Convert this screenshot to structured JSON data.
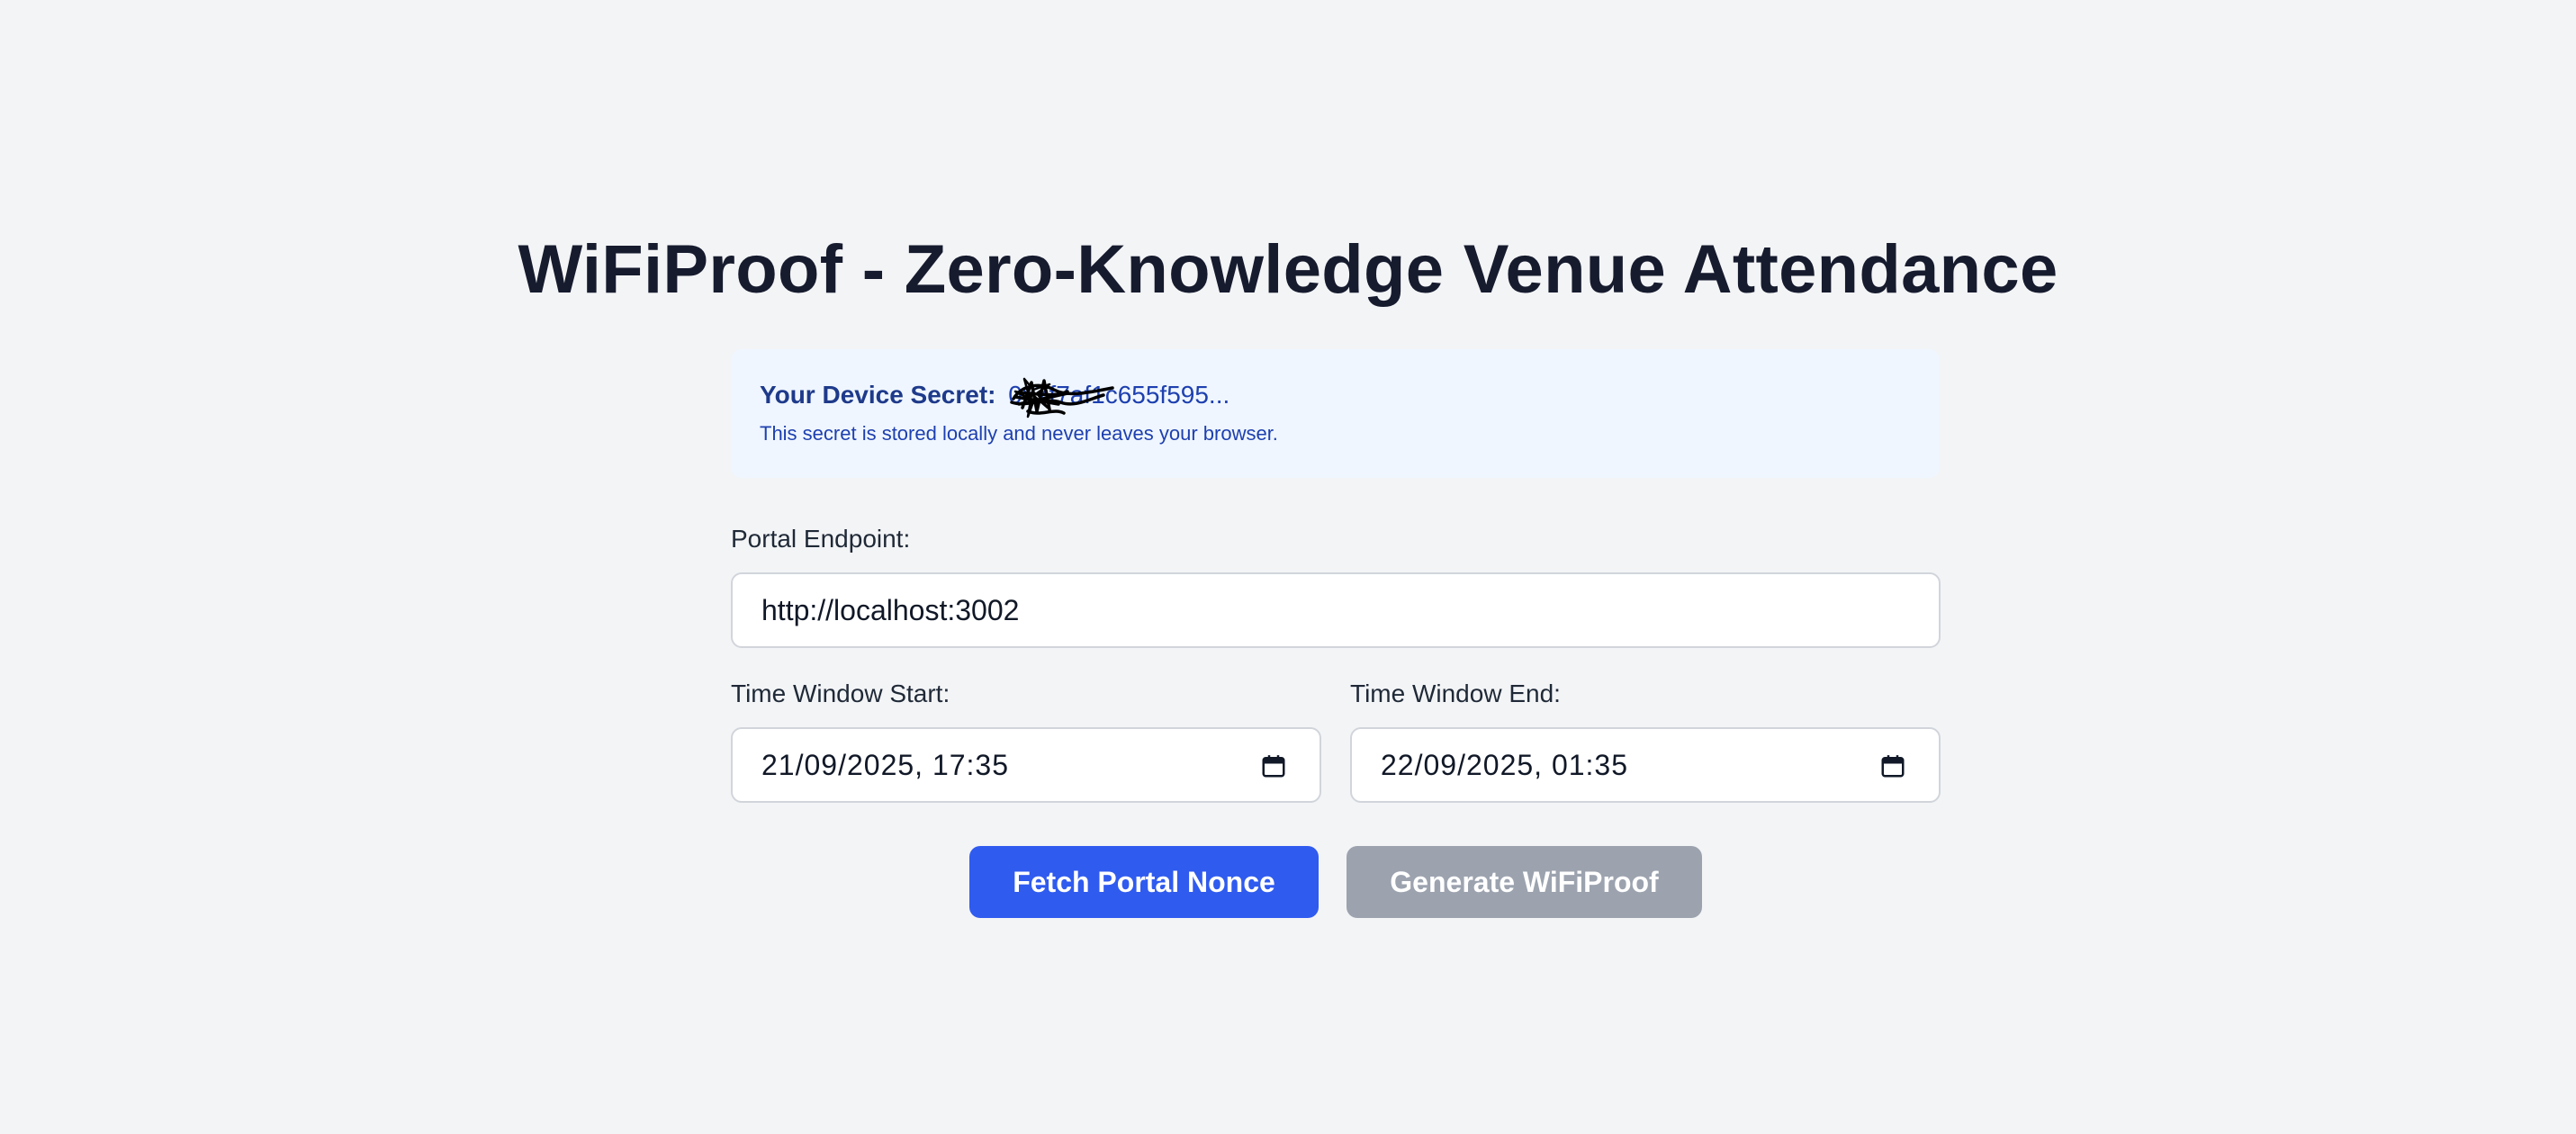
{
  "page": {
    "title": "WiFiProof - Zero-Knowledge Venue Attendance"
  },
  "secret": {
    "label": "Your Device Secret:",
    "value": "0x7f7af1c655f595...",
    "note": "This secret is stored locally and never leaves your browser."
  },
  "portal": {
    "label": "Portal Endpoint:",
    "value": "http://localhost:3002"
  },
  "time_window": {
    "start_label": "Time Window Start:",
    "start_value": "21/09/2025, 17:35",
    "end_label": "Time Window End:",
    "end_value": "22/09/2025, 01:35"
  },
  "actions": {
    "fetch_label": "Fetch Portal Nonce",
    "generate_label": "Generate WiFiProof",
    "generate_disabled": true
  },
  "icons": {
    "date_picker": "calendar-icon",
    "redaction": "scribble-redaction"
  },
  "colors": {
    "background": "#f3f4f6",
    "primary": "#2f5bef",
    "disabled": "#9ca3af",
    "secret_card": "#eff6ff",
    "secret_text": "#1e3a8a"
  }
}
